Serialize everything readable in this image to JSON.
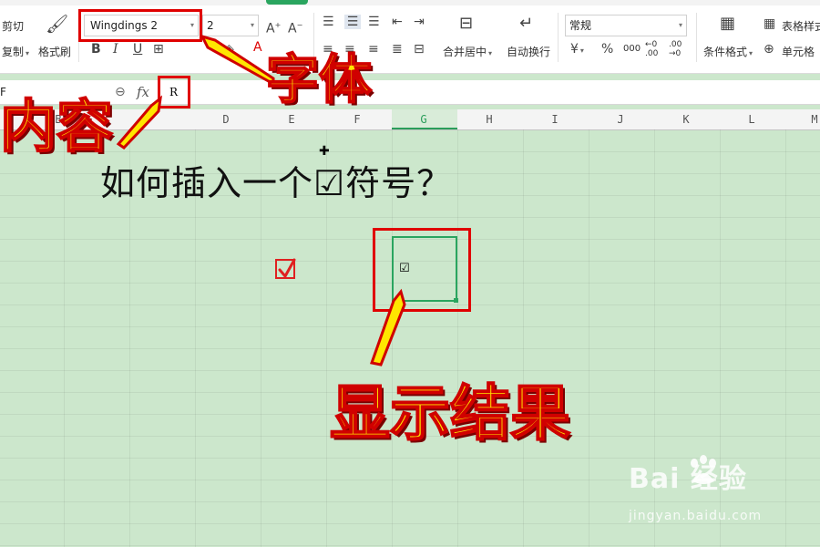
{
  "ribbon": {
    "cut_label": "剪切",
    "copy_label": "复制",
    "format_painter_label": "格式刷",
    "font_name": "Wingdings 2",
    "font_size": "2",
    "merge_center_label": "合并居中",
    "wrap_text_label": "自动换行",
    "number_format": "常规",
    "currency_symbol": "¥",
    "percent_symbol": "%",
    "thousands_symbol": "000",
    "dec_increase_symbol": "←0 .00",
    "dec_decrease_symbol": ".00 →0",
    "conditional_format_label": "条件格式",
    "table_style_label": "表格样式",
    "cell_style_label": "单元格"
  },
  "formula_bar": {
    "fx_label": "fx",
    "cell_value": "R"
  },
  "columns": [
    "B",
    "D",
    "E",
    "F",
    "G",
    "H",
    "I",
    "J",
    "K",
    "L",
    "M"
  ],
  "sheet": {
    "heading": "如何插入一个☑符号？",
    "cell_content": "☑"
  },
  "annotations": {
    "font_callout": "字体",
    "content_callout": "内容",
    "result_callout": "显示结果"
  },
  "watermark": {
    "brand": "Bai  经验",
    "url": "jingyan.baidu.com"
  },
  "colors": {
    "accent_green": "#2aa55f",
    "callout_yellow": "#ffe600",
    "callout_red": "#e00000",
    "sheet_bg": "#cce7cc"
  }
}
